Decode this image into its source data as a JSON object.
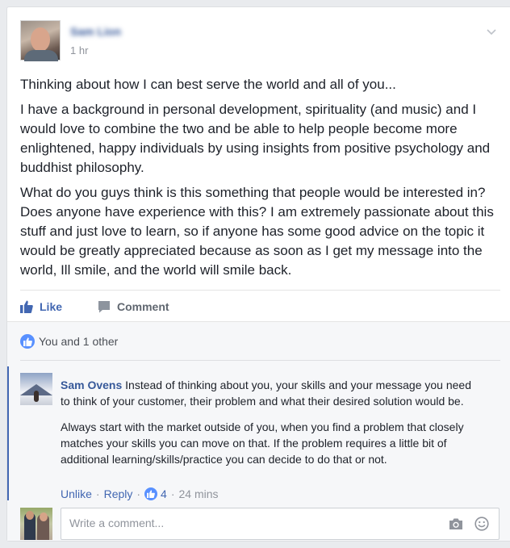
{
  "post": {
    "author_name": "Sam Lion",
    "timestamp": "1 hr",
    "paragraphs": [
      "Thinking about how I can best serve the world and all of you...",
      "I have a background in personal development, spirituality (and music) and I would love to combine the two and be able to help people become more enlightened, happy individuals by using insights from positive psychology and buddhist philosophy.",
      "What do you guys think is this something that people would be interested in? Does anyone have experience with this? I am extremely passionate about this stuff and just love to learn, so if anyone has some good advice on the topic it would be greatly appreciated because as soon as I get my message into the world, Ill smile, and the world will smile back."
    ]
  },
  "actions": {
    "like_label": "Like",
    "comment_label": "Comment"
  },
  "likes": {
    "summary": "You and 1 other"
  },
  "comment": {
    "author": "Sam Ovens",
    "text_1": "Instead of thinking about you, your skills and your message you need to think of your customer, their problem and what their desired solution would be.",
    "text_2": "Always start with the market outside of you, when you find a problem that closely matches your skills you can move on that. If the problem requires a little bit of additional learning/skills/practice you can decide to do that or not.",
    "unlike_label": "Unlike",
    "reply_label": "Reply",
    "reaction_count": "4",
    "timestamp": "24 mins"
  },
  "composer": {
    "placeholder": "Write a comment..."
  },
  "icons": {
    "dropdown": "chevron-down-icon",
    "like": "thumbs-up-icon",
    "comment": "speech-bubble-icon",
    "camera": "camera-icon",
    "emoji": "smiley-icon"
  },
  "colors": {
    "link": "#365899",
    "accent": "#4267b2",
    "like_bubble": "#5890ff"
  }
}
